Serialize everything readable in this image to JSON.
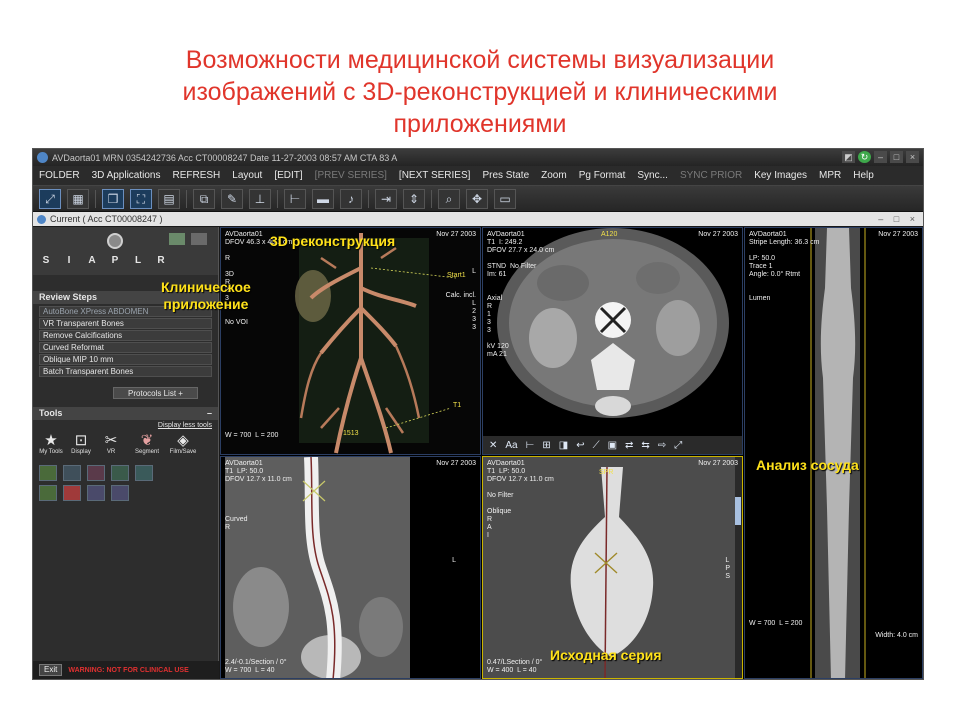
{
  "slide": {
    "title_lines": [
      "Возможности медицинской системы визуализации",
      "изображений с 3D-реконструкцией и клиническими",
      "приложениями"
    ]
  },
  "window": {
    "title": "AVDaorta01   MRN 0354242736   Acc CT00008247   Date 11-27-2003   08:57 AM   CTA  83 A"
  },
  "menu": [
    {
      "label": "FOLDER",
      "enabled": true
    },
    {
      "label": "3D Applications",
      "enabled": true
    },
    {
      "label": "REFRESH",
      "enabled": true
    },
    {
      "label": "Layout",
      "enabled": true
    },
    {
      "label": "[EDIT]",
      "enabled": true
    },
    {
      "label": "[PREV SERIES]",
      "enabled": false
    },
    {
      "label": "[NEXT SERIES]",
      "enabled": true
    },
    {
      "label": "Pres State",
      "enabled": true
    },
    {
      "label": "Zoom",
      "enabled": true
    },
    {
      "label": "Pg Format",
      "enabled": true
    },
    {
      "label": "Sync...",
      "enabled": true
    },
    {
      "label": "SYNC PRIOR",
      "enabled": false
    },
    {
      "label": "Key Images",
      "enabled": true
    },
    {
      "label": "MPR",
      "enabled": true
    },
    {
      "label": "Help",
      "enabled": true
    }
  ],
  "toolbar_icons": [
    "expand-icon",
    "grid-layout-icon",
    "cube-icon",
    "patient-table-icon",
    "film-icon",
    "copy-icon",
    "wand-icon",
    "axis-icon",
    "ruler-icon",
    "save-icon",
    "microphone-icon",
    "export-icon",
    "up-down-icon",
    "zoom-icon",
    "pan-icon",
    "film-strip-icon"
  ],
  "document_bar": {
    "title": "Current ( Acc  CT00008247 )"
  },
  "left_panel": {
    "orientation": [
      "S",
      "I",
      "A",
      "P",
      "L",
      "R"
    ],
    "review_steps_title": "Review Steps",
    "review_steps": [
      "AutoBone XPress ABDOMEN",
      "VR Transparent Bones",
      "Remove Calcifications",
      "Curved Reformat",
      "Oblique MIP 10 mm",
      "Batch Transparent Bones"
    ],
    "protocols_label": "Protocols List  +",
    "tools_title": "Tools",
    "display_less_label": "Display less tools",
    "tools": [
      {
        "icon": "star-icon",
        "label": "My Tools"
      },
      {
        "icon": "text-annotation-icon",
        "label": "Display"
      },
      {
        "icon": "vr-icon",
        "label": "VR"
      },
      {
        "icon": "segment-icon",
        "label": "Segment"
      },
      {
        "icon": "film-save-icon",
        "label": "Film/Save"
      }
    ],
    "exit_label": "Exit",
    "warning_text": "WARNING: NOT FOR CLINICAL USE"
  },
  "viewports": {
    "vr": {
      "tl": "AVDaorta01\nDFOV 46.3 x 40.1 cm\n\nR\n\n3D\nR\n2\n3\n1\n\nNo VOI",
      "tr": "Nov 27 2003",
      "right_labels": "L\n\n\nCalc. incl.\nL\n2\n3\n3",
      "bl": "W = 700  L = 200",
      "marker1": "Start1",
      "marker2": "T1",
      "slice_num": "1513"
    },
    "axial": {
      "tl": "AVDaorta01\nT1  I: 249.2\nDFOV 27.7 x 24.0 cm\n\nSTND  No Filter\nIm: 61\n\n\nAxial\nR\n1\n3\n3\n\nkV 120\nmA 21",
      "tr": "Nov 27 2003",
      "top_label": "A120"
    },
    "lumen": {
      "tl": "AVDaorta01\nStripe Length: 36.3 cm\n\nLP: 50.0\nTrace 1\nAngle: 0.0° Rtmt\n\n\nLumen",
      "tr": "Nov 27 2003",
      "bl": "W = 700  L = 200",
      "br": "Width: 4.0 cm"
    },
    "curved": {
      "tl": "AVDaorta01\nT1  LP: 50.0\nDFOV 12.7 x 11.0 cm\n\n\n\n\nCurved\nR",
      "tr": "Nov 27 2003",
      "right_label": "L",
      "bl": "2.4/-0.1/Section / 0°\nW = 700  L = 40"
    },
    "oblique": {
      "tl": "AVDaorta01\nT1  LP: 50.0\nDFOV 12.7 x 11.0 cm\n\nNo Filter\n\nOblique\nR\nA\nI",
      "tr": "Nov 27 2003",
      "top_label": "SPR",
      "right_label": "L\nP\nS",
      "bl": "0.47/LSection / 0°\nW = 400  L = 40"
    }
  },
  "callouts": {
    "reconstruction": "3D реконструкция",
    "clinical_line1": "Клиническое",
    "clinical_line2": "приложение",
    "vessel": "Анализ сосуда",
    "source": "Исходная серия"
  }
}
